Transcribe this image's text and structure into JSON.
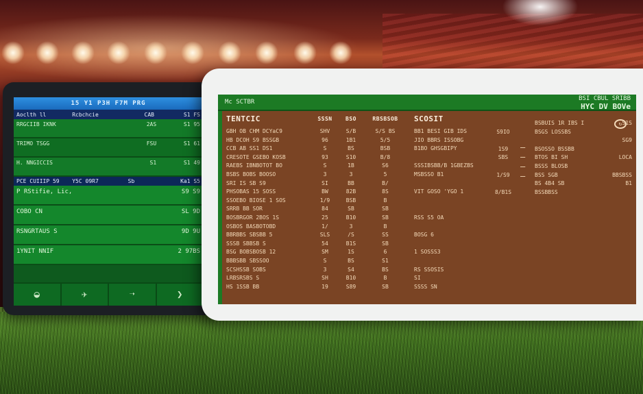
{
  "scene": {
    "colors": {
      "sky_top": "#4a1414",
      "grass": "#3f6e1e",
      "left_screen": "#0e5a1e",
      "right_screen": "#7a4424",
      "bar_green": "#1c7a24",
      "bar_blue": "#1a6bbd"
    }
  },
  "left_tablet": {
    "topbar": "15 Y1 P3H F7M PRG",
    "header": [
      "Aoclth ll",
      "Rcbchcie",
      "CAB",
      "S1 FS"
    ],
    "rows_a": [
      {
        "c1": "RRGCIIB IKNK",
        "c2": "2AS",
        "c3": "S1 95"
      },
      {
        "c1": "TRIMO TSGG",
        "c2": "FSU",
        "c3": "S1 61"
      },
      {
        "c1": "H. NNGICCIS",
        "c2": "S1",
        "c3": "S1 49"
      }
    ],
    "section": [
      "PCE CUIIIP 59 10",
      "Y5C 09R7",
      "Sb",
      "Ka1 S5"
    ],
    "rows_b": [
      {
        "c1": "P RStifie, Lic,",
        "c2": "S9 S9"
      },
      {
        "c1": "COBO CN",
        "c2": "SL 9D"
      },
      {
        "c1": "RSNGRTAUS S",
        "c2": "9D 9U"
      },
      {
        "c1": "1YNIT NNIF",
        "c2": "2 97BS"
      }
    ],
    "tabs": [
      {
        "icon": "field-icon",
        "glyph": "◒"
      },
      {
        "icon": "player-icon",
        "glyph": "✈"
      },
      {
        "icon": "arrow-icon",
        "glyph": "➝"
      },
      {
        "icon": "more-icon",
        "glyph": "❯"
      }
    ]
  },
  "right_tablet": {
    "topbar_left": "Mc SCTBR",
    "topbar_right": [
      "BSI CBUL SRIBB",
      "HYC DV BOVe"
    ],
    "col1": {
      "header": "TENTCIC",
      "lines": [
        "GBH OB CHM DCYaC9",
        "HB DCOH S9 BSSGB",
        "CCB AB SS1 DS1",
        "CRESOTE GSEBO KOSB",
        "RAEBS IBNBOTOT BO",
        "BSBS BOBS BOOSO",
        "SRI IS SB S9",
        "PHSOBAS 15 SOSS",
        "SSOEBO BIOSE 1 SOS",
        "SRRB BB SOR",
        "BOSBRGOR 2BOS 1S",
        "OSBOS BASBOTOBD",
        "BBRBBS SBSBB 5",
        "SSSB SBBSB S",
        "BSG BOBSBOSB 12",
        "BBBSBB SBSSOO",
        "SCSHSSB SOBS",
        "LRBSRSBS S",
        "HS 1SSB BB"
      ]
    },
    "col2": {
      "header": "SSSN",
      "lines": [
        "SHV",
        "96",
        "S",
        "93",
        "S",
        "3",
        "SI",
        "BW",
        "1/9",
        "84",
        "25",
        "1/",
        "SLS",
        "54",
        "SM",
        "S",
        "3",
        "SH",
        "19"
      ]
    },
    "col3": {
      "header": "BSO",
      "lines": [
        "S/B",
        "1B1",
        "BS",
        "S10",
        "1B",
        "3",
        "BB",
        "82B",
        "BSB",
        "SB",
        "B10",
        "3",
        "/S",
        "B1S",
        "1S",
        "BS",
        "S4",
        "B10",
        "S89"
      ]
    },
    "col4": {
      "header": "RBSBSOB",
      "lines": [
        "S/S BS",
        "5/5",
        "BSB",
        "B/8",
        "S6",
        "5",
        "B/",
        "8S",
        "B",
        "SB",
        "SB",
        "B",
        "SS",
        "SB",
        "6",
        "S1",
        "BS",
        "B",
        "SB"
      ]
    },
    "col5": {
      "header": "SCOSIT",
      "lines": [
        "BB1 BESI GIB IDS",
        "JIO BBRS ISSOBG",
        "B1BO GHSGBIPY",
        "",
        "SSSIBSBB/B 1GBEZBS",
        "MSBSSO B1",
        "",
        "VIT GOSO 'YGO 1",
        "",
        "",
        "RSS S5 OA",
        "",
        "BOSG 6",
        "",
        "1 SOSSS3",
        "",
        "RS SSOSIS",
        "SI",
        "SSSS SN"
      ]
    },
    "col6": {
      "header": "",
      "lines": [
        "",
        "S9IO",
        "",
        "1S9",
        "SBS",
        "",
        "1/S9",
        "",
        "8/B1S",
        ""
      ]
    },
    "col7": {
      "header": "",
      "lines": [
        "BSBUIS 1R IBS I",
        "BSGS LOSSBS",
        "",
        "BSOSSO BSSBB",
        "BTOS BI SH",
        "BSSS BLOSB",
        "BSS SGB",
        "BS 4B4 SB",
        "BSSBBSS"
      ]
    },
    "col8": {
      "header": "",
      "lines": [
        "S1S",
        "",
        "SG9",
        "",
        "LOCA",
        "",
        "BBSBSS",
        "B1"
      ]
    }
  }
}
